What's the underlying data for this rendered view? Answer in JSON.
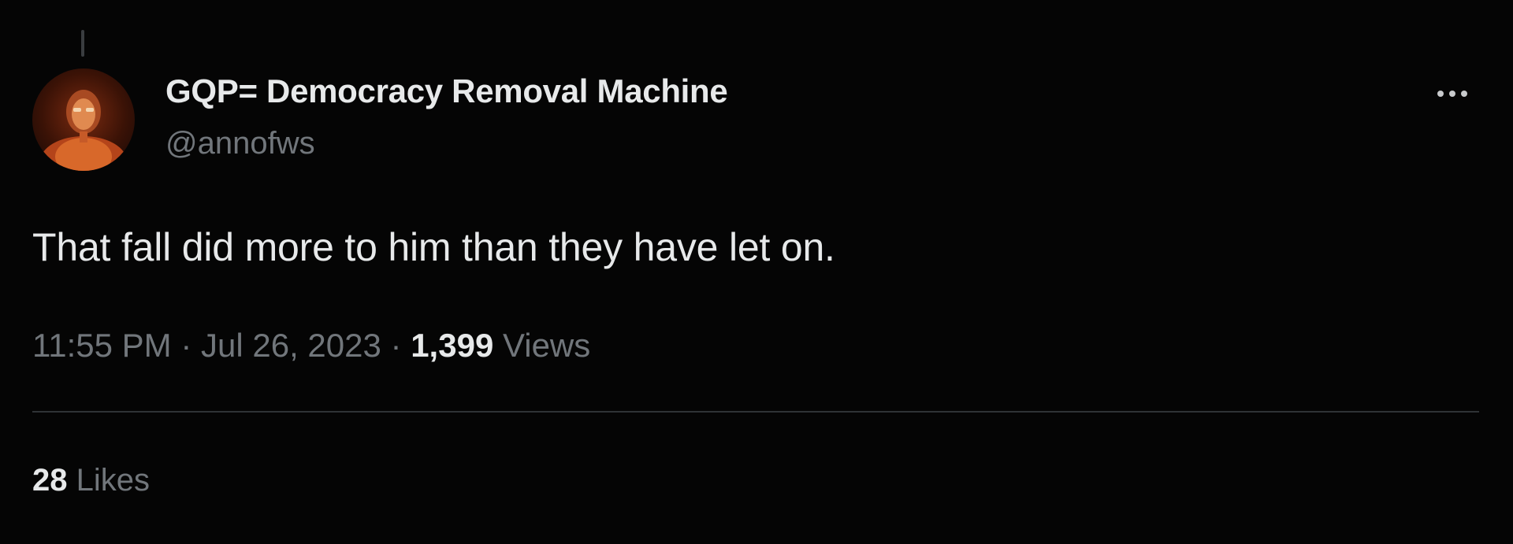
{
  "author": {
    "display_name": "GQP= Democracy Removal Machine",
    "handle": "@annofws",
    "avatar_icon": "profile-photo"
  },
  "menu": {
    "more_icon": "ellipsis-icon"
  },
  "tweet": {
    "text": "That fall did more to him than they have let on.",
    "time": "11:55 PM",
    "separator": "·",
    "date": "Jul 26, 2023",
    "views_count": "1,399",
    "views_label": "Views"
  },
  "stats": {
    "likes_count": "28",
    "likes_label": "Likes"
  },
  "colors": {
    "background": "#050505",
    "primary_text": "#e7e9ea",
    "secondary_text": "#71767b",
    "divider": "#2f3336"
  }
}
